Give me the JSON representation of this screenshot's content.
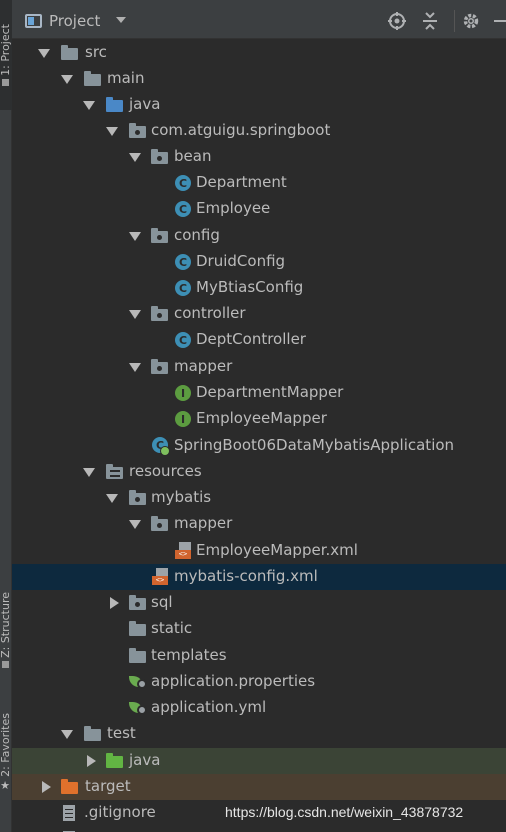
{
  "side_tabs": {
    "project": "1: Project",
    "structure": "Z: Structure",
    "favorites": "2: Favorites"
  },
  "header": {
    "title": "Project",
    "icons": [
      "locate-icon",
      "collapse-all-icon",
      "gear-icon",
      "hide-icon"
    ]
  },
  "tree": {
    "src": "src",
    "main": "main",
    "java": "java",
    "package": "com.atguigu.springboot",
    "bean": "bean",
    "department": "Department",
    "employee": "Employee",
    "config": "config",
    "druid_config": "DruidConfig",
    "mybatis_config_class": "MyBtiasConfig",
    "controller": "controller",
    "dept_controller": "DeptController",
    "mapper": "mapper",
    "department_mapper": "DepartmentMapper",
    "employee_mapper": "EmployeeMapper",
    "app_class": "SpringBoot06DataMybatisApplication",
    "resources": "resources",
    "mybatis": "mybatis",
    "res_mapper": "mapper",
    "employee_mapper_xml": "EmployeeMapper.xml",
    "mybatis_config_xml": "mybatis-config.xml",
    "sql": "sql",
    "static": "static",
    "templates": "templates",
    "app_properties": "application.properties",
    "app_yml": "application.yml",
    "test": "test",
    "test_java": "java",
    "target": "target",
    "gitignore": ".gitignore"
  },
  "icon_glyphs": {
    "class": "C",
    "interface": "I",
    "xml": "<>"
  },
  "colors": {
    "background": "#2b2b2b",
    "header": "#3c3f41",
    "selection": "#0d293e",
    "test_row": "#3b4436",
    "target_row": "#4b3f31"
  },
  "watermark": "https://blog.csdn.net/weixin_43878732"
}
